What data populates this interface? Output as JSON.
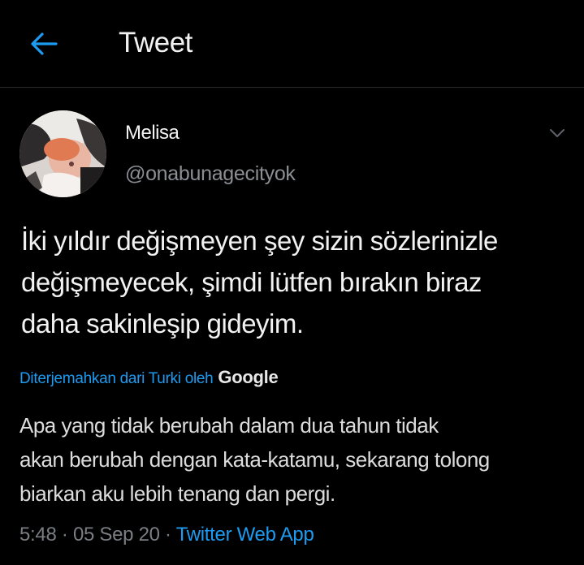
{
  "header": {
    "back_icon": "arrow-left-icon",
    "title": "Tweet"
  },
  "colors": {
    "accent": "#1d9bf0",
    "background": "#000000",
    "text_primary": "#f2f2f2",
    "text_secondary": "#8b8f94"
  },
  "tweet": {
    "author": {
      "name": "Melisa",
      "handle": "@onabunagecityok",
      "avatar_icon": "user-avatar"
    },
    "more_icon": "chevron-down-icon",
    "text_lines": [
      "İki yıldır değişmeyen şey sizin sözlerinizle",
      "değişmeyecek, şimdi lütfen bırakın biraz",
      "daha sakinleşip gideyim."
    ],
    "translation": {
      "label": "Diterjemahkan dari Turki oleh",
      "provider": "Google",
      "text_lines": [
        "Apa yang tidak berubah dalam dua tahun tidak",
        "akan berubah dengan kata-katamu, sekarang tolong",
        "biarkan aku lebih tenang dan pergi."
      ]
    },
    "meta": {
      "time": "5:48",
      "separator": " · ",
      "date": "05 Sep 20",
      "source": "Twitter Web App"
    }
  }
}
